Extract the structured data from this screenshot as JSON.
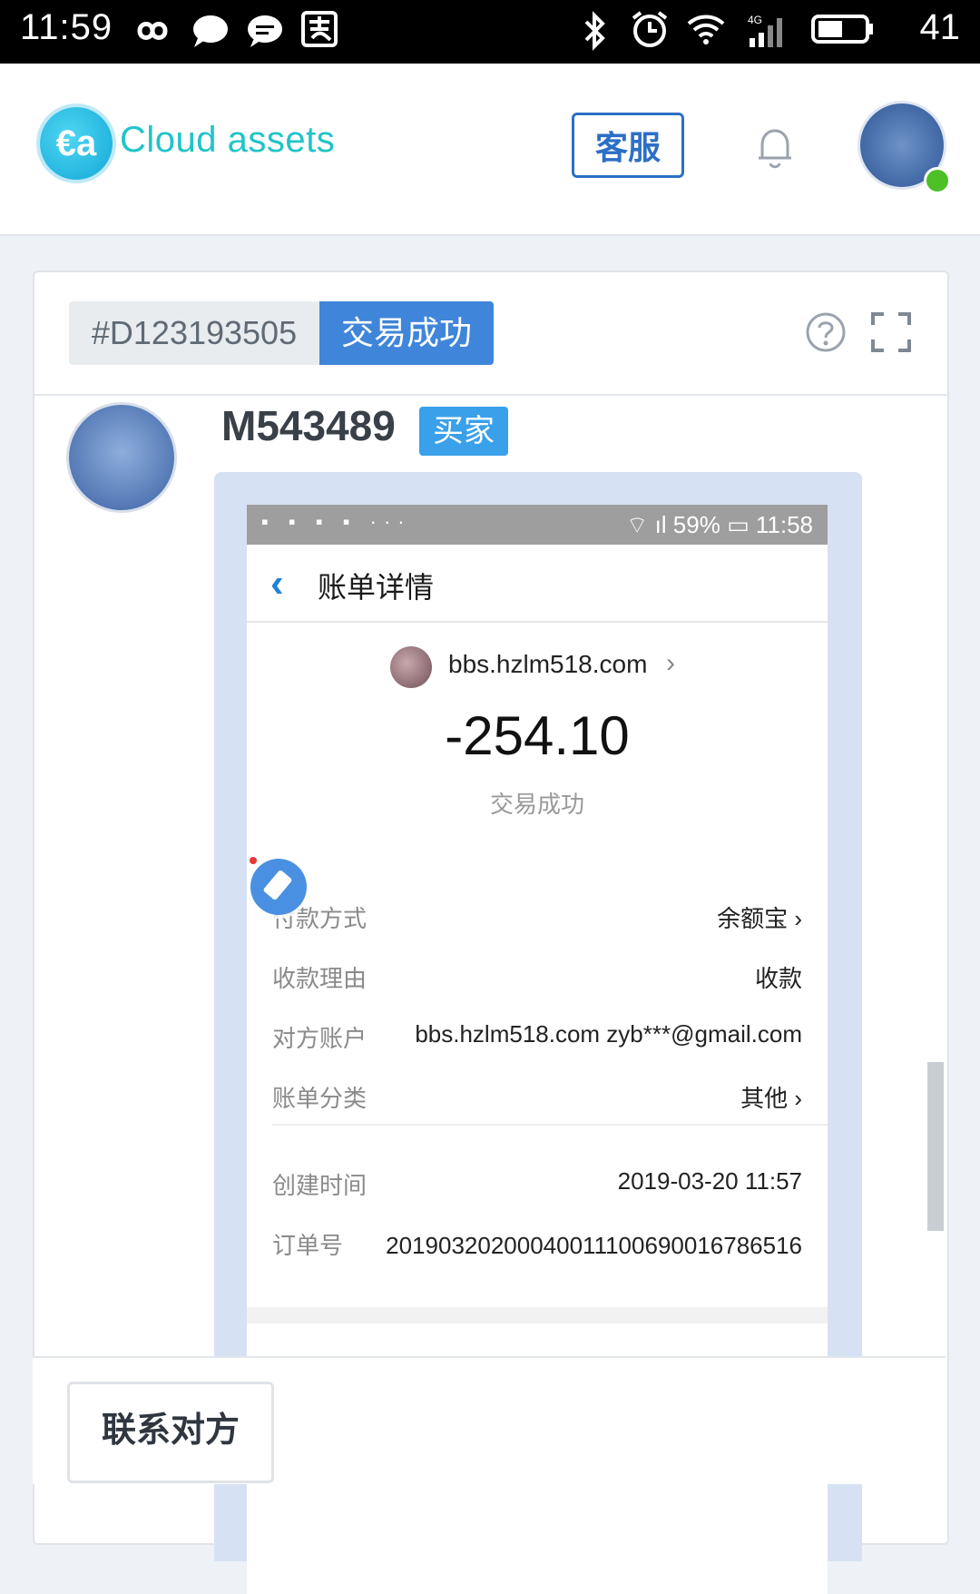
{
  "status_bar": {
    "time": "11:59",
    "battery": "41",
    "icons": [
      "infinity-icon",
      "chat-bubble-icon",
      "message-icon",
      "alipay-icon",
      "bluetooth-icon",
      "alarm-icon",
      "wifi-icon",
      "signal-4g-icon",
      "battery-icon"
    ]
  },
  "header": {
    "logo_text": "Cloud assets",
    "customer_service_label": "客服",
    "bell_icon": "bell-icon",
    "avatar_status_color": "#4cc026"
  },
  "order": {
    "id": "#D123193505",
    "status": "交易成功",
    "help_icon": "help-icon",
    "expand_icon": "expand-icon"
  },
  "buyer": {
    "name": "M543489",
    "tag": "买家"
  },
  "screenshot": {
    "phone_status_time": "11:58",
    "phone_battery": "59%",
    "page_title": "账单详情",
    "merchant": "bbs.hzlm518.com",
    "amount": "-254.10",
    "trade_status": "交易成功",
    "rows": [
      {
        "key": "付款方式",
        "value": "余额宝 ›"
      },
      {
        "key": "收款理由",
        "value": "收款"
      },
      {
        "key": "对方账户",
        "value": "bbs.hzlm518.com zyb***@gmail.com"
      },
      {
        "key": "账单分类",
        "value": "其他 ›"
      },
      {
        "key": "创建时间",
        "value": "2019-03-20 11:57"
      },
      {
        "key": "订单号",
        "value": "20190320200040011100690016786516"
      }
    ]
  },
  "footer": {
    "contact_label": "联系对方"
  },
  "colors": {
    "accent": "#3f85d9",
    "buyer_tag": "#3aa0ea",
    "logo": "#20c4c8"
  }
}
